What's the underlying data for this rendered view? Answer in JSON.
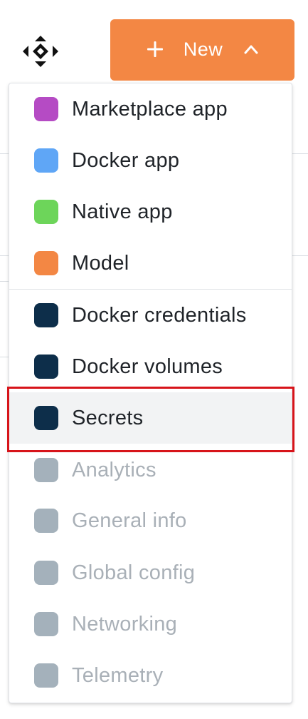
{
  "header": {
    "move_icon": "move-arrows-icon",
    "new_button": {
      "label": "New",
      "plus_icon": "plus-icon",
      "chevron_icon": "chevron-up-icon",
      "color": "#f38744"
    }
  },
  "menu": {
    "items": [
      {
        "label": "Marketplace app",
        "color": "#b54bc4",
        "enabled": true
      },
      {
        "label": "Docker app",
        "color": "#5fa6f6",
        "enabled": true
      },
      {
        "label": "Native app",
        "color": "#6dd55a",
        "enabled": true
      },
      {
        "label": "Model",
        "color": "#f38744",
        "enabled": true
      },
      {
        "label": "Docker credentials",
        "color": "#0d2e4a",
        "enabled": true
      },
      {
        "label": "Docker volumes",
        "color": "#0d2e4a",
        "enabled": true
      },
      {
        "label": "Secrets",
        "color": "#0d2e4a",
        "enabled": true,
        "selected": true
      },
      {
        "label": "Analytics",
        "color": "#a4b1bb",
        "enabled": false
      },
      {
        "label": "General info",
        "color": "#a4b1bb",
        "enabled": false
      },
      {
        "label": "Global config",
        "color": "#a4b1bb",
        "enabled": false
      },
      {
        "label": "Networking",
        "color": "#a4b1bb",
        "enabled": false
      },
      {
        "label": "Telemetry",
        "color": "#a4b1bb",
        "enabled": false
      }
    ],
    "highlight_color": "#d7141a"
  }
}
